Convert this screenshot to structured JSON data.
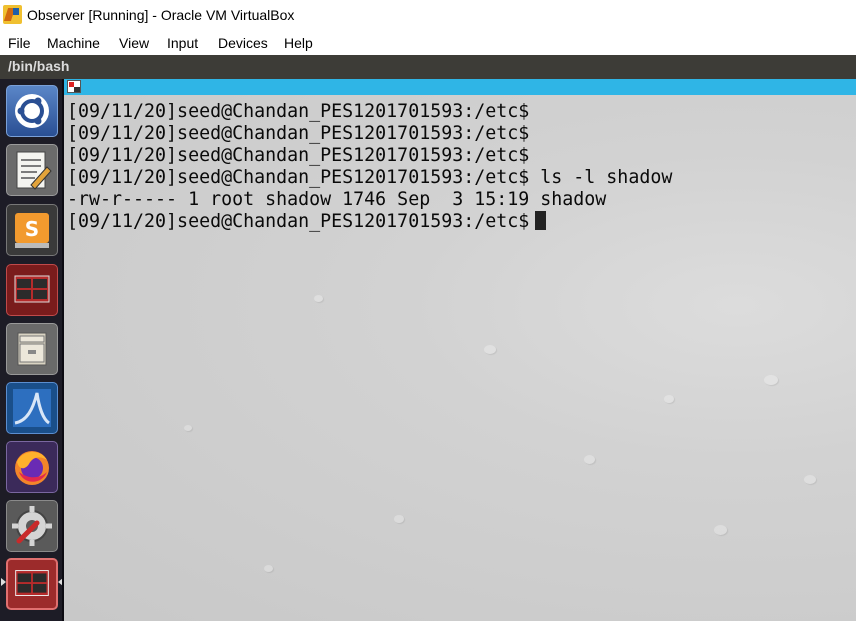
{
  "window": {
    "title": "Observer [Running] - Oracle VM VirtualBox",
    "icon": "virtualbox-icon"
  },
  "menu": {
    "items": [
      "File",
      "Machine",
      "View",
      "Input",
      "Devices",
      "Help"
    ]
  },
  "guest": {
    "window_title": "/bin/bash"
  },
  "launcher": {
    "items": [
      {
        "name": "ubuntu-dash-icon"
      },
      {
        "name": "text-editor-icon"
      },
      {
        "name": "sublime-text-icon"
      },
      {
        "name": "terminal-icon"
      },
      {
        "name": "file-manager-icon"
      },
      {
        "name": "wireshark-icon"
      },
      {
        "name": "firefox-icon"
      },
      {
        "name": "system-settings-icon"
      },
      {
        "name": "terminal-active-icon"
      }
    ]
  },
  "terminal": {
    "lines": [
      "[09/11/20]seed@Chandan_PES1201701593:/etc$",
      "[09/11/20]seed@Chandan_PES1201701593:/etc$",
      "[09/11/20]seed@Chandan_PES1201701593:/etc$",
      "[09/11/20]seed@Chandan_PES1201701593:/etc$ ls -l shadow",
      "-rw-r----- 1 root shadow 1746 Sep  3 15:19 shadow",
      "[09/11/20]seed@Chandan_PES1201701593:/etc$"
    ]
  },
  "colors": {
    "host_titlebar": "#ffffff",
    "guest_titlebar": "#3d3c37",
    "launcher_bg": "#1d1c26",
    "terminal_tab": "#2fb5e6",
    "terminal_text": "#0a0a0a"
  }
}
